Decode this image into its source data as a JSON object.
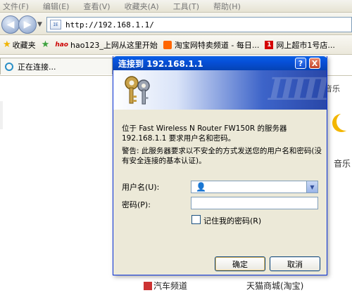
{
  "menu": [
    "文件(F)",
    "编辑(E)",
    "查看(V)",
    "收藏夹(A)",
    "工具(T)",
    "帮助(H)"
  ],
  "address": {
    "icon_text": "IE",
    "url": "http://192.168.1.1/"
  },
  "favorites": {
    "label": "收藏夹",
    "items": [
      {
        "badge": "hao",
        "label": "hao123_上网从这里开始"
      },
      {
        "label": "淘宝网特卖频道 - 每日..."
      },
      {
        "badge": "1",
        "label": "网上超市1号店..."
      }
    ]
  },
  "tab": {
    "label": "正在连接..."
  },
  "page": {
    "music1": "音乐",
    "music2": "音乐",
    "link1": "汽车频道",
    "link2": "天猫商城(淘宝)"
  },
  "dialog": {
    "title": "连接到 192.168.1.1",
    "help_btn": "?",
    "close_btn": "X",
    "message": "位于 Fast Wireless N Router FW150R 的服务器 192.168.1.1 要求用户名和密码。",
    "warning": "警告: 此服务器要求以不安全的方式发送您的用户名和密码(没有安全连接的基本认证)。",
    "username_label": "用户名(U):",
    "password_label": "密码(P):",
    "username_value": "",
    "password_value": "",
    "remember_label": "记住我的密码(R)",
    "remember_checked": false,
    "ok_label": "确定",
    "cancel_label": "取消"
  }
}
